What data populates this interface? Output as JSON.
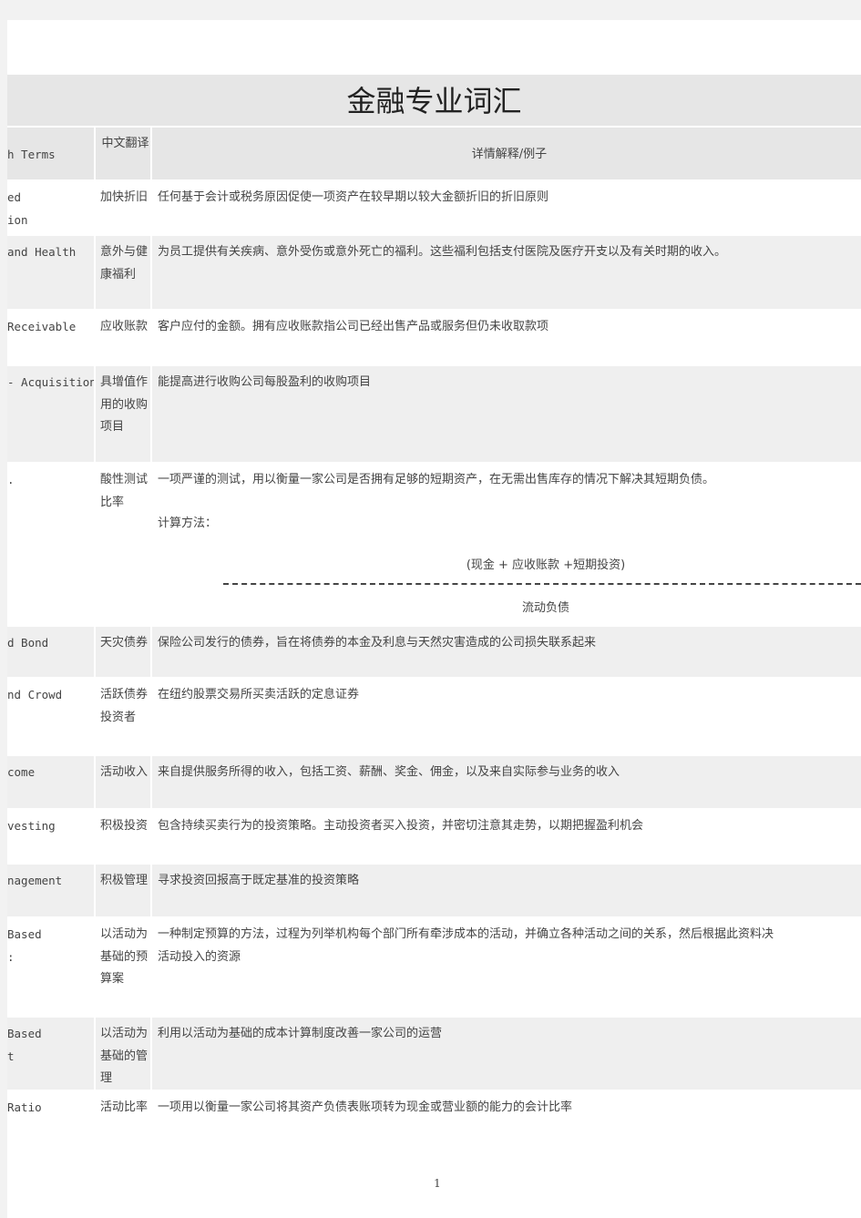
{
  "title": "金融专业词汇",
  "header": {
    "english": "h Terms",
    "chinese": "中文翻译",
    "detail": "详情解释/例子"
  },
  "rows": [
    {
      "en": [
        "ed",
        "ion"
      ],
      "cn": "加快折旧",
      "detail": [
        "任何基于会计或税务原因促使一项资产在较早期以较大金额折旧的折旧原则"
      ]
    },
    {
      "en": [
        "and Health"
      ],
      "cn": "意外与健康福利",
      "detail": [
        "为员工提供有关疾病、意外受伤或意外死亡的福利。这些福利包括支付医院及医疗开支以及有关时期的收入。"
      ]
    },
    {
      "en": [
        "Receivable"
      ],
      "cn": "应收账款",
      "detail": [
        "客户应付的金额。拥有应收账款指公司已经出售产品或服务但仍未收取款项"
      ]
    },
    {
      "en": [
        "- Acquisition"
      ],
      "cn": "具增值作用的收购项目",
      "detail": [
        "能提高进行收购公司每股盈利的收购项目"
      ]
    },
    {
      "en": [
        "."
      ],
      "cn": "酸性测试比率",
      "detail": [
        "一项严谨的测试，用以衡量一家公司是否拥有足够的短期资产，在无需出售库存的情况下解决其短期负债。",
        "计算方法："
      ],
      "formula": {
        "numerator": "(现金 + 应收账款 +短期投资)",
        "denominator": "流动负债"
      }
    },
    {
      "en": [
        "d Bond"
      ],
      "cn": "天灾债券",
      "detail": [
        "保险公司发行的债券，旨在将债券的本金及利息与天然灾害造成的公司损失联系起来"
      ]
    },
    {
      "en": [
        "nd Crowd"
      ],
      "cn": "活跃债券投资者",
      "detail": [
        "在纽约股票交易所买卖活跃的定息证券"
      ]
    },
    {
      "en": [
        "come"
      ],
      "cn": "活动收入",
      "detail": [
        "来自提供服务所得的收入，包括工资、薪酬、奖金、佣金，以及来自实际参与业务的收入"
      ]
    },
    {
      "en": [
        "vesting"
      ],
      "cn": "积极投资",
      "detail": [
        "包含持续买卖行为的投资策略。主动投资者买入投资，并密切注意其走势，以期把握盈利机会"
      ]
    },
    {
      "en": [
        "nagement"
      ],
      "cn": "积极管理",
      "detail": [
        "寻求投资回报高于既定基准的投资策略"
      ]
    },
    {
      "en": [
        "Based",
        ":"
      ],
      "cn": "以活动为基础的预算案",
      "detail": [
        "一种制定预算的方法，过程为列举机构每个部门所有牵涉成本的活动，并确立各种活动之间的关系，然后根据此资料决",
        "活动投入的资源"
      ]
    },
    {
      "en": [
        "Based",
        "t"
      ],
      "cn": "以活动为基础的管理",
      "detail": [
        "利用以活动为基础的成本计算制度改善一家公司的运营"
      ]
    },
    {
      "en": [
        "Ratio"
      ],
      "cn": "活动比率",
      "detail": [
        "一项用以衡量一家公司将其资产负债表账项转为现金或营业额的能力的会计比率"
      ]
    }
  ],
  "page_number": "1"
}
